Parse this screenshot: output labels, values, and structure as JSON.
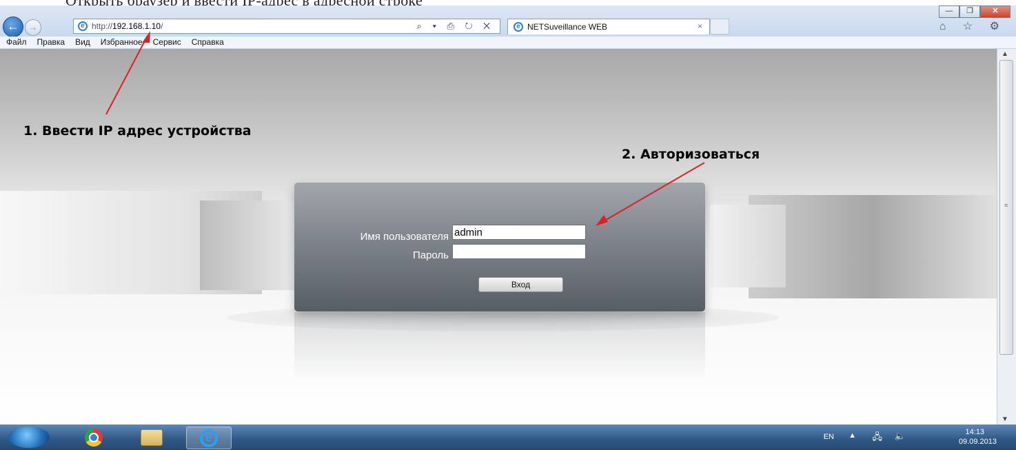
{
  "header_fragment": "Открыть браузер и ввести IP-адрес в адресной строке",
  "window": {
    "minimize": "—",
    "restore": "❐",
    "close": "✕"
  },
  "browser": {
    "url_prefix": "http://",
    "url_host": "192.168.1.10",
    "url_suffix": "/",
    "address_tools": "⌕ ▾ ⎙ ↻ ✕",
    "tab_title": "NETSuveillance WEB",
    "tab_close": "×",
    "right_icons": "⌂ ☆ ⚙",
    "menu": [
      "Файл",
      "Правка",
      "Вид",
      "Избранное",
      "Сервис",
      "Справка"
    ]
  },
  "login": {
    "username_label": "Имя пользователя",
    "username_value": "admin",
    "password_label": "Пароль",
    "password_value": "",
    "submit_label": "Вход"
  },
  "annotations": {
    "step1": "1. Ввести IP адрес устройства",
    "step2": "2. Авторизоваться"
  },
  "scrollbar": {
    "up": "▲",
    "down": "▼",
    "grip": "≡"
  },
  "taskbar": {
    "language": "EN",
    "tray_arrow": "▲",
    "network_icon": "🖧",
    "volume_icon": "🔈",
    "time": "14:13",
    "date": "09.09.2013"
  }
}
